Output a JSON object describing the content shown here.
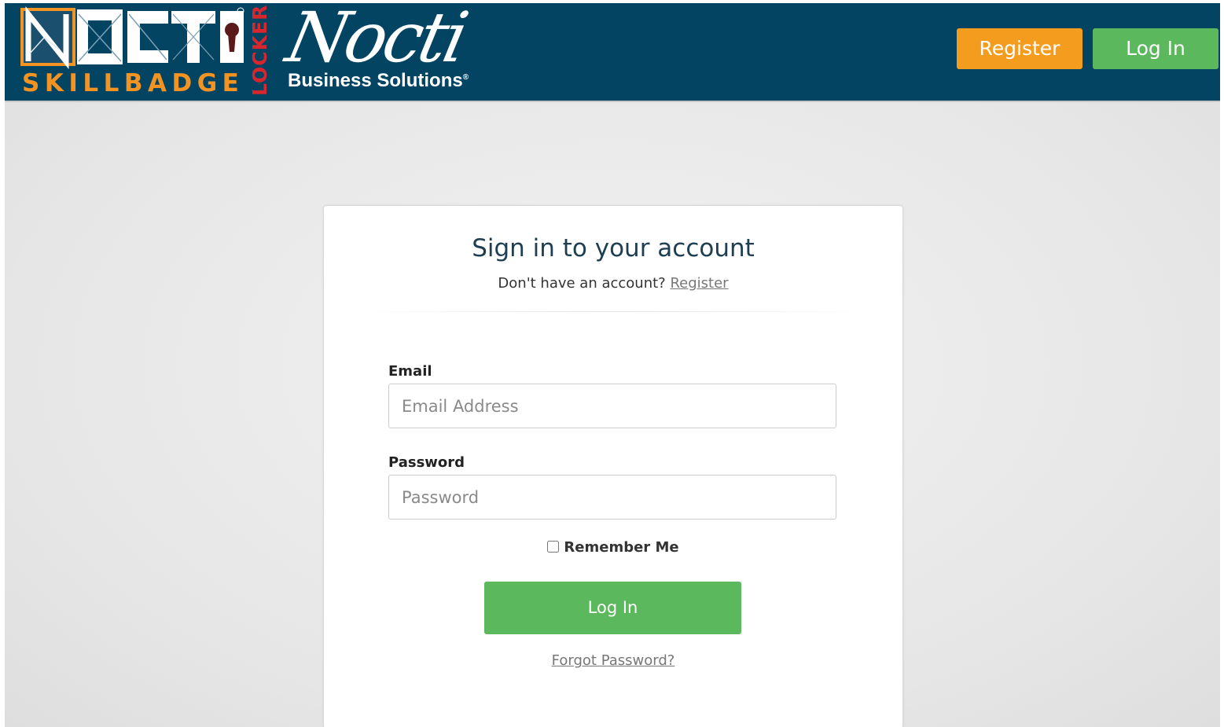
{
  "header": {
    "brand_badge": {
      "logo_text": "NOCTI",
      "tagline": "SKILLBADGE",
      "side_text": "LOCKER"
    },
    "brand_business": {
      "script_text": "Nocti",
      "subtitle": "Business Solutions",
      "registered_mark": "®"
    },
    "register_label": "Register",
    "login_label": "Log In"
  },
  "login_card": {
    "title": "Sign in to your account",
    "no_account_text": "Don't have an account?",
    "register_link": "Register",
    "email_label": "Email",
    "email_placeholder": "Email Address",
    "email_value": "",
    "password_label": "Password",
    "password_placeholder": "Password",
    "password_value": "",
    "remember_label": "Remember Me",
    "remember_checked": false,
    "login_button": "Log In",
    "forgot_link": "Forgot Password?"
  },
  "colors": {
    "header_bg": "#034463",
    "register_button": "#f39c1d",
    "login_button": "#5cb85c",
    "logo_orange": "#f29322",
    "logo_red": "#d8262e"
  },
  "icons": {
    "badge_logo": "nocti-skillbadge-locker-logo",
    "keyhole": "keyhole-icon"
  }
}
